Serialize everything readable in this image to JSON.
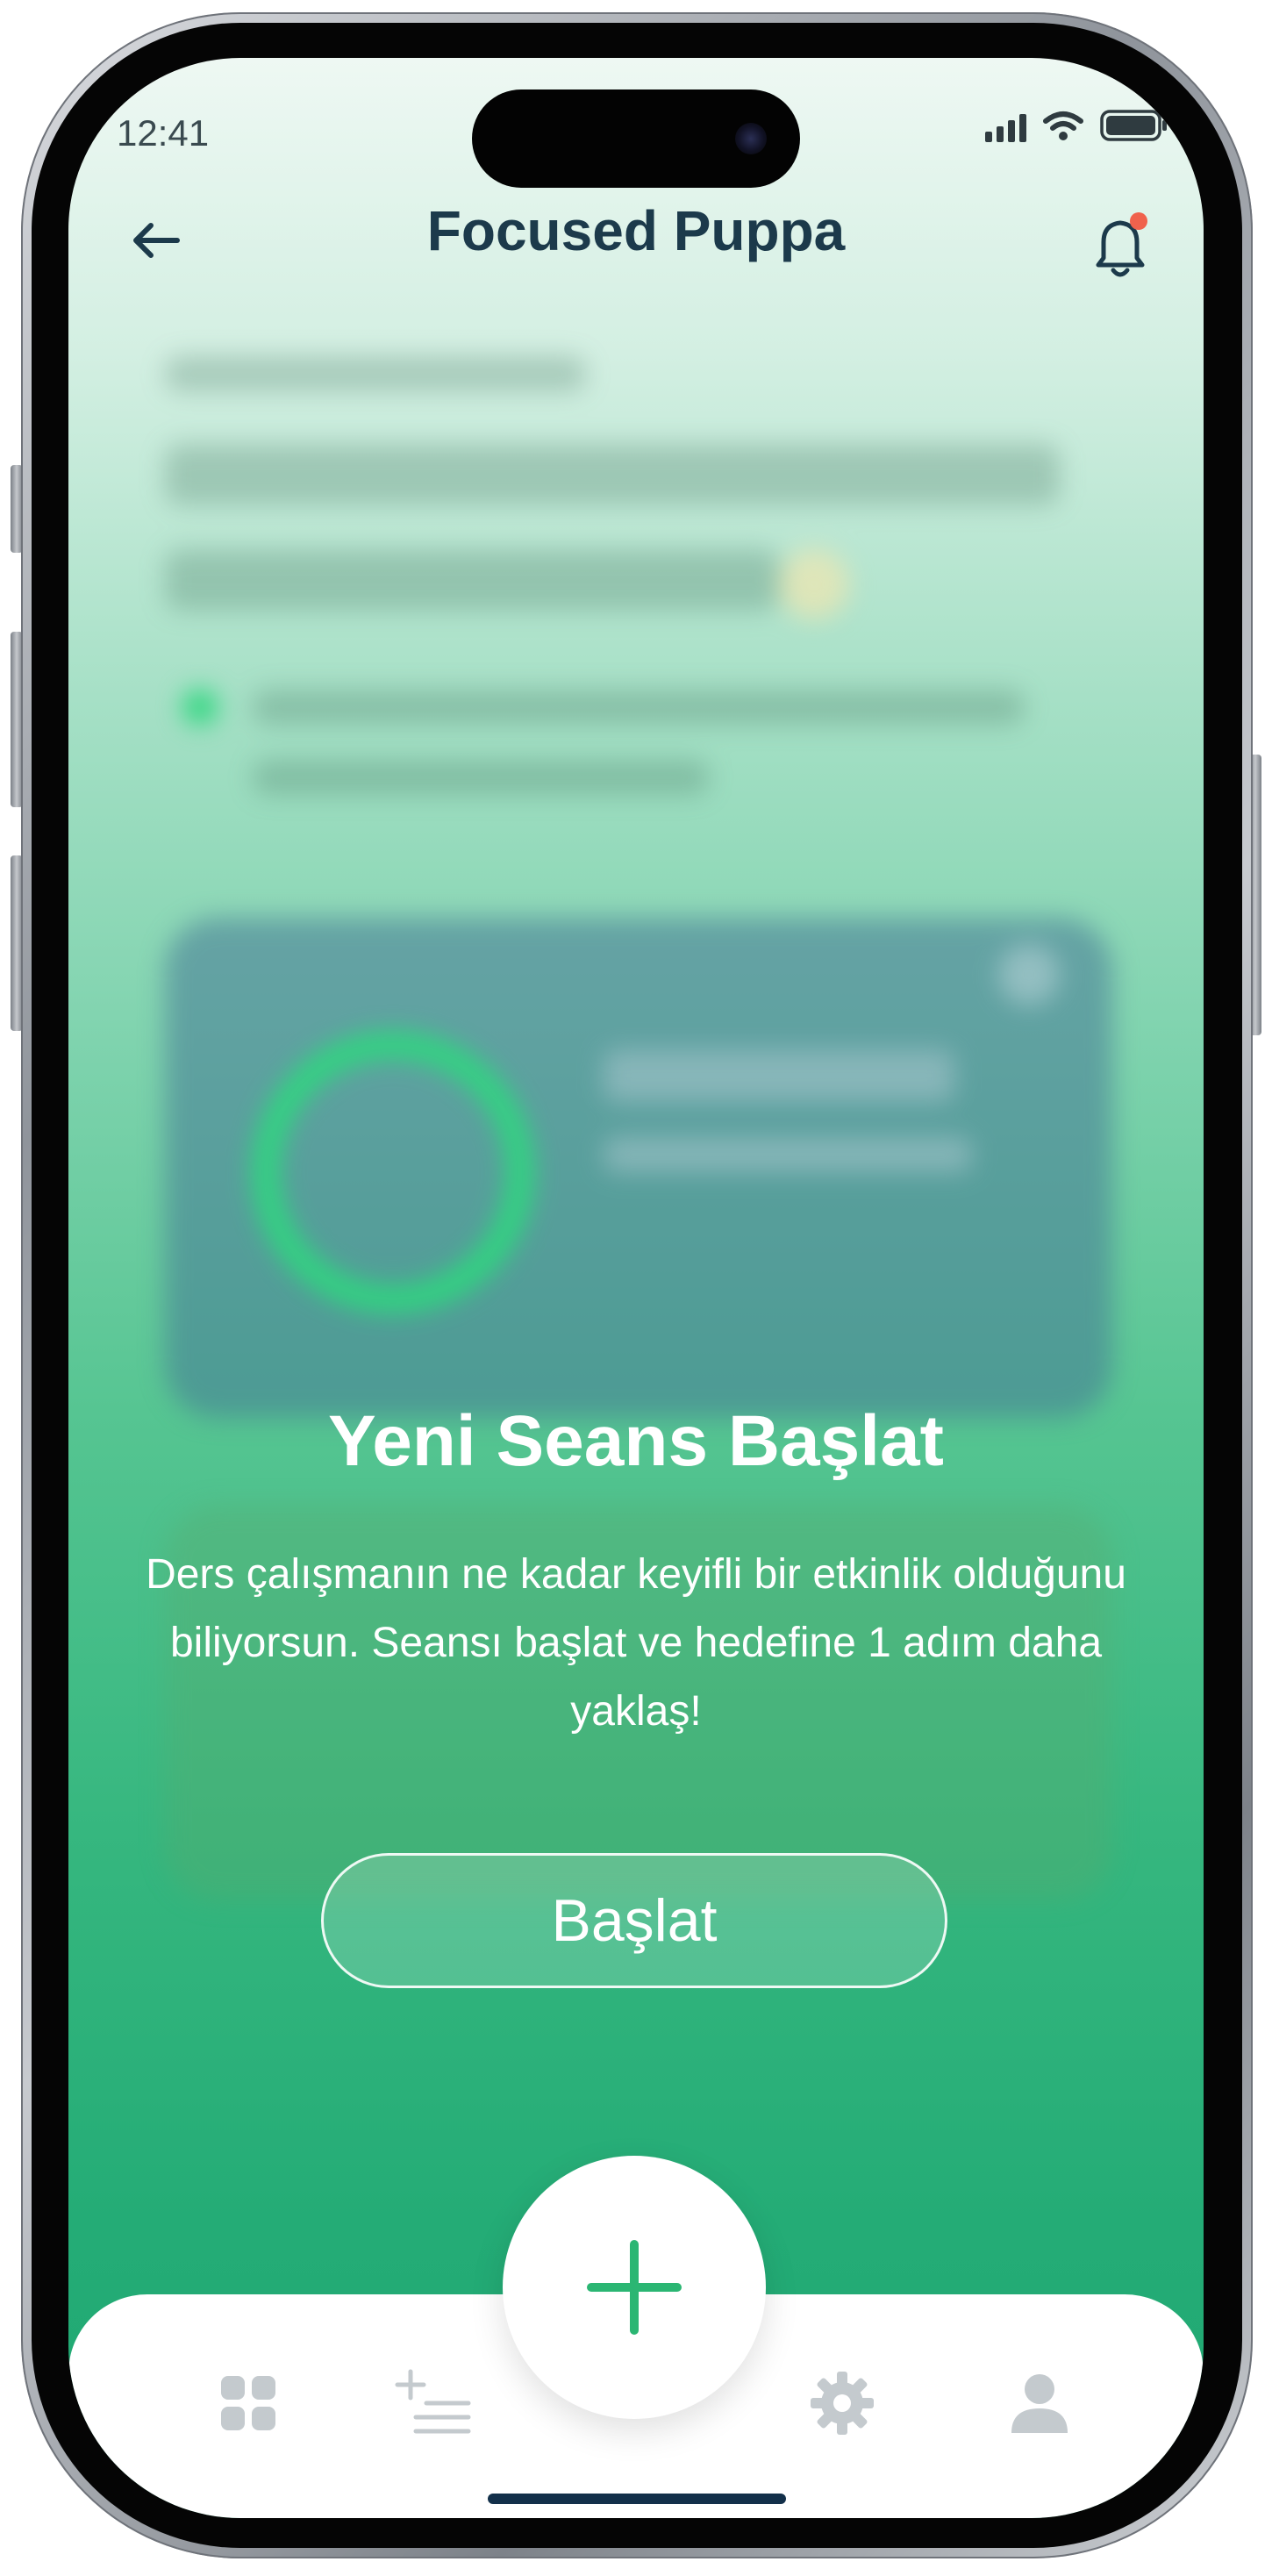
{
  "status_bar": {
    "time": "12:41"
  },
  "header": {
    "title": "Focused Puppa",
    "back_icon": "arrow-left-icon",
    "notification_icon": "bell-icon"
  },
  "session_modal": {
    "title": "Yeni Seans Başlat",
    "description": "Ders çalışmanın ne kadar keyifli bir etkinlik olduğunu biliyorsun. Seansı başlat ve hedefine 1 adım daha yaklaş!",
    "button_label": "Başlat"
  },
  "tab_bar": {
    "items": [
      {
        "icon": "grid-icon"
      },
      {
        "icon": "add-list-icon"
      },
      {
        "icon": "plus-icon"
      },
      {
        "icon": "gear-icon"
      },
      {
        "icon": "user-icon"
      }
    ]
  },
  "colors": {
    "accent_green": "#2bb673",
    "title_navy": "#1c3a4b",
    "notification_dot": "#f0624d",
    "inactive_icon": "#c4cace"
  }
}
